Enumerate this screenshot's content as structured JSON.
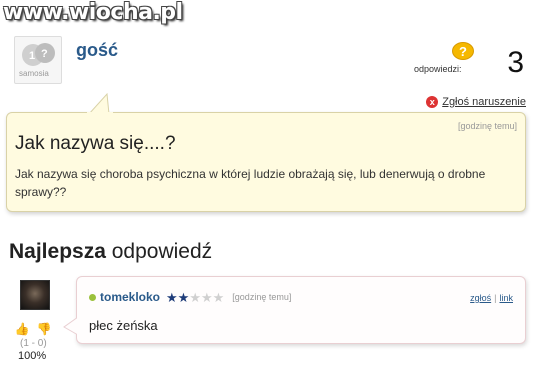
{
  "watermark": "www.wiocha.pl",
  "question": {
    "avatar_label": "samosia",
    "user": "gość",
    "answers_label": "odpowiedzi:",
    "answers_count": "3",
    "report_label": "Zgłoś naruszenie",
    "time": "[godzinę temu]",
    "title": "Jak nazywa się....?",
    "text": "Jak nazywa się choroba psychiczna w której ludzie obrażają się, lub denerwują o drobne sprawy??"
  },
  "best_answer": {
    "heading_bold": "Najlepsza",
    "heading_rest": " odpowiedź",
    "user": "tomekloko",
    "rating": 2,
    "rating_max": 5,
    "time": "[godzinę temu]",
    "report_link": "zgłoś",
    "link_label": "link",
    "text": "płec żeńska",
    "vote_tally": "(1 - 0)",
    "vote_pct": "100%"
  },
  "icons": {
    "question_mark": "?",
    "report": "x",
    "thumb_up": "👍",
    "thumb_down": "👎",
    "star": "★"
  },
  "colors": {
    "username": "#2a5a8a",
    "question_bubble": "#fffbe0",
    "rating_on": "#1f3d7a",
    "online_dot": "#9bc13c"
  }
}
